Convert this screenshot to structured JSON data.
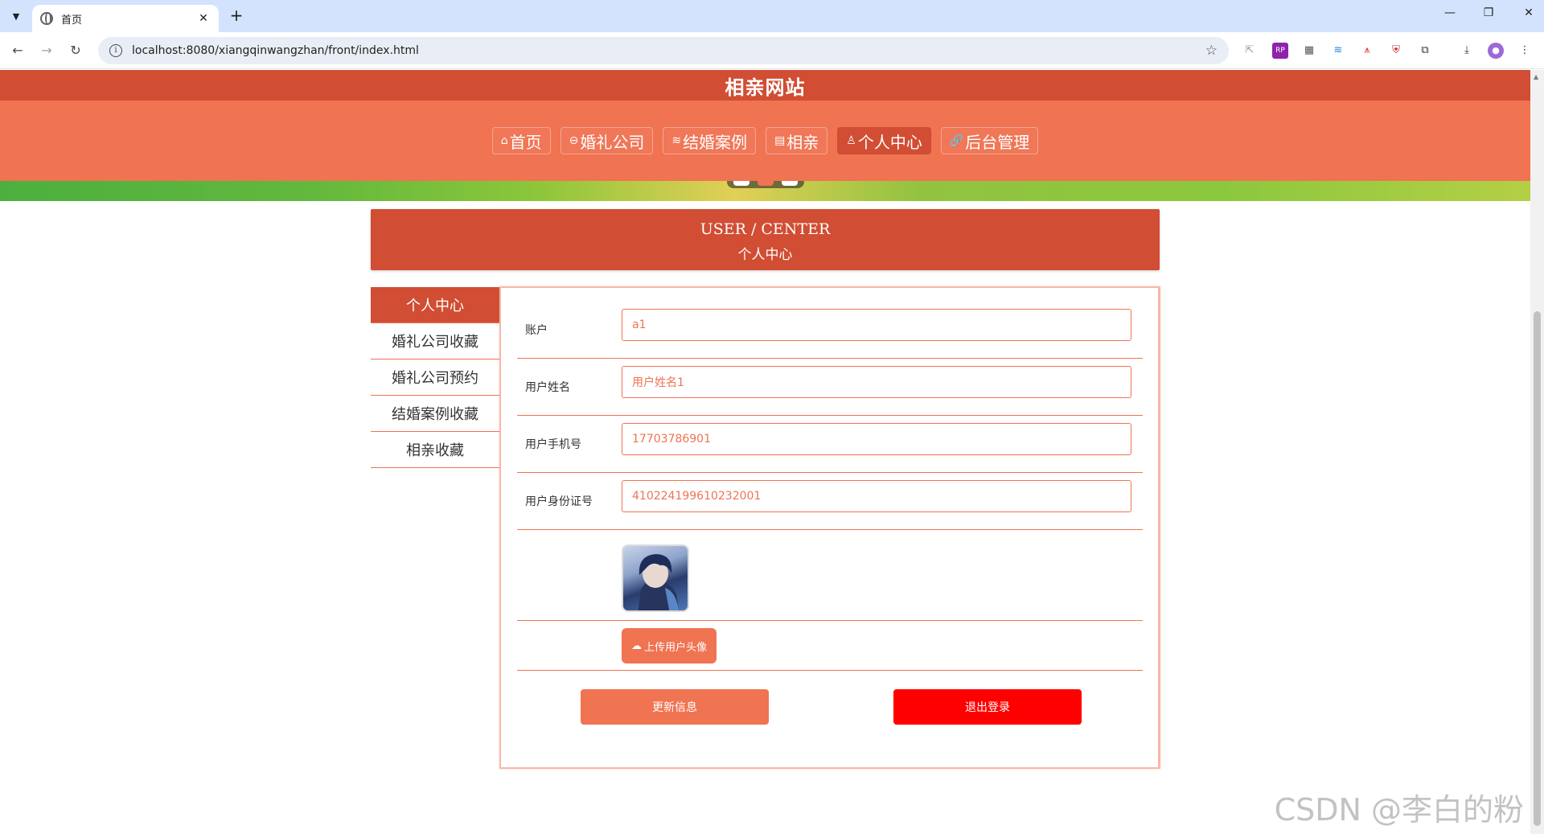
{
  "browser": {
    "tab_title": "首页",
    "url": "localhost:8080/xiangqinwangzhan/front/index.html",
    "window_controls": [
      "—",
      "❐",
      "✕"
    ]
  },
  "site": {
    "title": "相亲网站",
    "nav": [
      {
        "icon": "⌂",
        "label": "首页",
        "icon_name": "home-icon"
      },
      {
        "icon": "⊖",
        "label": "婚礼公司",
        "icon_name": "company-icon"
      },
      {
        "icon": "≋",
        "label": "结婚案例",
        "icon_name": "list-icon"
      },
      {
        "icon": "▤",
        "label": "相亲",
        "icon_name": "document-icon"
      },
      {
        "icon": "♙",
        "label": "个人中心",
        "icon_name": "user-icon"
      },
      {
        "icon": "🔗",
        "label": "后台管理",
        "icon_name": "link-icon"
      }
    ],
    "active_nav": "个人中心"
  },
  "section": {
    "title_en": "USER / CENTER",
    "title_cn": "个人中心"
  },
  "sidebar": {
    "items": [
      "个人中心",
      "婚礼公司收藏",
      "婚礼公司预约",
      "结婚案例收藏",
      "相亲收藏"
    ],
    "active": "个人中心"
  },
  "form": {
    "fields": [
      {
        "label": "账户",
        "value": "a1"
      },
      {
        "label": "用户姓名",
        "value": "用户姓名1"
      },
      {
        "label": "用户手机号",
        "value": "17703786901"
      },
      {
        "label": "用户身份证号",
        "value": "410224199610232001"
      }
    ],
    "upload_label": "上传用户头像",
    "update_label": "更新信息",
    "logout_label": "退出登录"
  },
  "colors": {
    "primary": "#d14d33",
    "accent": "#f07352",
    "danger": "#ff0000"
  },
  "watermark": "CSDN @李白的粉"
}
